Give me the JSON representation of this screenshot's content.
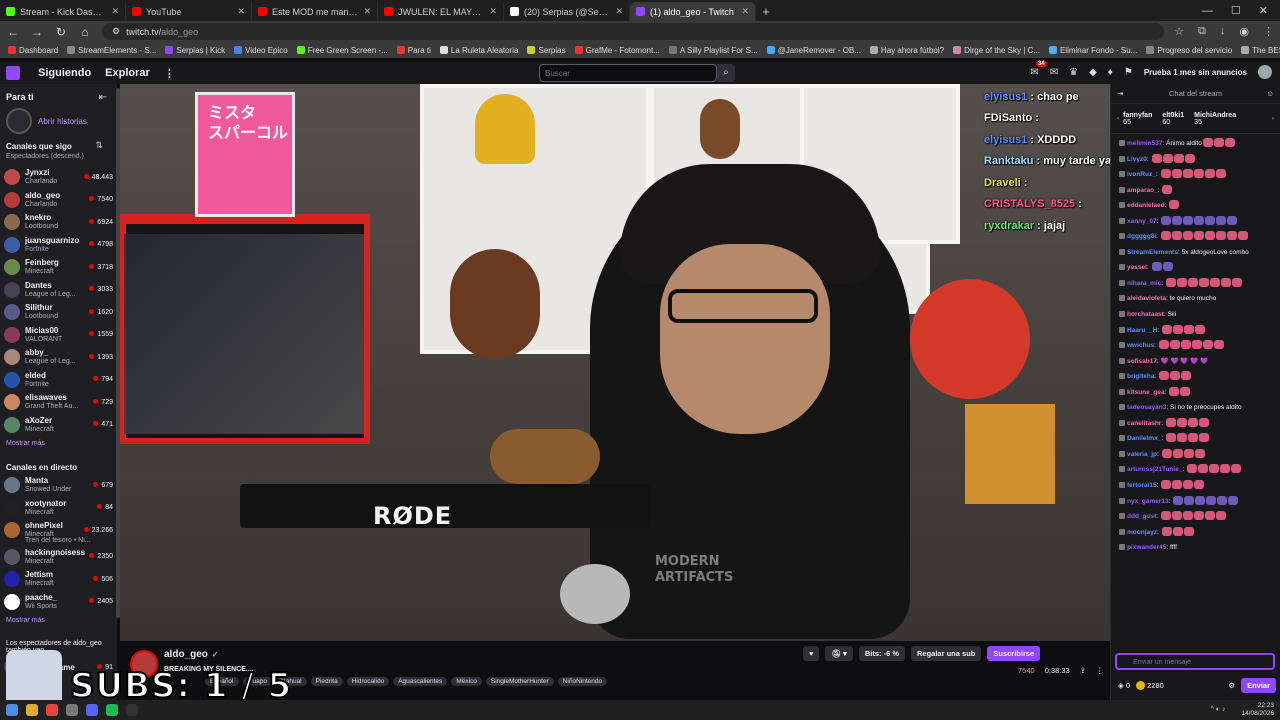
{
  "browser": {
    "tabs": [
      {
        "label": "Stream - Kick Dashboard",
        "color": "#53fc18"
      },
      {
        "label": "YouTube",
        "color": "#ff0000"
      },
      {
        "label": "Este MOD me mandó a TERAPIA",
        "color": "#ff0000"
      },
      {
        "label": "JWULEN: EL MAYOR FRAUDE DE",
        "color": "#ff0000"
      },
      {
        "label": "(20) Serpias (@Serpias) / X",
        "color": "#ffffff"
      },
      {
        "label": "(1) aldo_geo - Twitch",
        "color": "#9147ff",
        "active": true
      }
    ],
    "new_tab": "+",
    "url_host": "twitch.tv/",
    "url_path": "aldo_geo",
    "bookmarks": [
      "Dashboard",
      "StreamElements - S...",
      "Serpias | Kick",
      "Video Epico",
      "Free Green Screen -...",
      "Para ti",
      "La Ruleta Aleatoria",
      "Serpias",
      "GrafMe - Fotomont...",
      "A Silly Playlist For S...",
      "@JaneRemover - OB...",
      "Hay ahora fútbol?",
      "Dirge of the Sky | C...",
      "Eliminar Fondo - Su...",
      "Progreso del servicio",
      "The BEST CS2 Settin...",
      "(2) TikTok - Make Yo..."
    ]
  },
  "topnav": {
    "following": "Siguiendo",
    "browse": "Explorar",
    "more": "⋮",
    "search_placeholder": "Buscar",
    "notif_count": "34",
    "prime": "Prueba 1 mes sin anuncios"
  },
  "sidebar": {
    "title": "Para ti",
    "history": "Abrir historias",
    "followed_title": "Canales que sigo",
    "followed_sub": "Espectadores (descend.)",
    "followed": [
      {
        "name": "Jynxzi",
        "game": "Charlando",
        "viewers": "48.443",
        "color": "#c24848"
      },
      {
        "name": "aldo_geo",
        "game": "Charlando",
        "viewers": "7540",
        "color": "#b53a3a"
      },
      {
        "name": "knekro",
        "game": "Lootbound",
        "viewers": "6924",
        "color": "#8a6a4a"
      },
      {
        "name": "juansguarnizo",
        "game": "Fortnite",
        "viewers": "4798",
        "color": "#3a5fa8"
      },
      {
        "name": "Feinberg",
        "game": "Minecraft",
        "viewers": "3718",
        "color": "#6a8a4a"
      },
      {
        "name": "Dantes",
        "game": "League of Leg...",
        "viewers": "3033",
        "color": "#444455"
      },
      {
        "name": "Silithur",
        "game": "Lootbound",
        "viewers": "1620",
        "color": "#5a5a8a"
      },
      {
        "name": "Micias00",
        "game": "VALORANT",
        "viewers": "1559",
        "color": "#8a3a5a"
      },
      {
        "name": "abby_",
        "game": "League of Leg...",
        "viewers": "1393",
        "color": "#aa8877"
      },
      {
        "name": "elded",
        "game": "Fortnite",
        "viewers": "794",
        "color": "#2255aa"
      },
      {
        "name": "elisawaves",
        "game": "Grand Theft Au...",
        "viewers": "729",
        "color": "#cc8866"
      },
      {
        "name": "aXoZer",
        "game": "Minecraft",
        "viewers": "471",
        "color": "#558866"
      }
    ],
    "show_more": "Mostrar más",
    "live_title": "Canales en directo",
    "live": [
      {
        "name": "Manta",
        "game": "Snowed Under",
        "viewers": "679",
        "color": "#667788"
      },
      {
        "name": "xootynator",
        "game": "Minecraft",
        "viewers": "84",
        "color": "#222222"
      },
      {
        "name": "ohnePixel",
        "game": "Minecraft",
        "viewers": "23.266",
        "color": "#aa6633",
        "extra": "Tren del tesoro • Ni..."
      },
      {
        "name": "hackingnoisess",
        "game": "Minecraft",
        "viewers": "2350",
        "color": "#555566"
      },
      {
        "name": "Jettism",
        "game": "Minecraft",
        "viewers": "506",
        "color": "#2222aa"
      },
      {
        "name": "paache_",
        "game": "Wii Sports",
        "viewers": "2405",
        "color": "#ffffff"
      }
    ],
    "show_more_2": "Mostrar más",
    "also_watch": "Los espectadores de aldo_geo también ven",
    "also": {
      "name": "Ataplaygame",
      "viewers": "91"
    }
  },
  "stream": {
    "name": "aldo_geo",
    "title": "BREAKING MY SILENCE....",
    "tags": [
      "Español",
      "Guapo",
      "Nahual",
      "Piedrita",
      "Hidrocalido",
      "Aguascalientes",
      "México",
      "SingleMotherHunter",
      "NiñoNintendo"
    ],
    "bits": "Bits: -6 %",
    "gift": "Regalar una sub",
    "subscribe": "Suscribirse",
    "viewers": "7540",
    "uptime": "0:38:33",
    "overlay_subs": "SUBS: 1 / 5",
    "mic_brand": "RØDE",
    "shirt": [
      "MODERN",
      "ARTIFACTS"
    ],
    "box_text": [
      "ミスタ",
      "スパーコル"
    ]
  },
  "overlay_chat": [
    {
      "user": "elyisus1",
      "color": "#5c8fff",
      "msg": "chao pe"
    },
    {
      "user": "FDiSanto",
      "color": "#ffffff",
      "msg": ""
    },
    {
      "user": "elyisus1",
      "color": "#5c8fff",
      "msg": "XDDDD"
    },
    {
      "user": "Ranktaku",
      "color": "#9fdcff",
      "msg": "muy tarde ya le dire hate a pumplow"
    },
    {
      "user": "Draveli",
      "color": "#e5e544",
      "msg": ""
    },
    {
      "user": "CRISTALYS_8525",
      "color": "#ff5a8a",
      "msg": ""
    },
    {
      "user": "ryxdrakar",
      "color": "#6fe06f",
      "msg": "jajaj"
    }
  ],
  "chat": {
    "title": "Chat del stream",
    "leaderboard": [
      {
        "name": "fannyfan",
        "pts": "65"
      },
      {
        "name": "elt0ki1",
        "pts": "60"
      },
      {
        "name": "MichiAndrea",
        "pts": "35"
      }
    ],
    "messages": [
      {
        "user": "melimin537",
        "color": "#9b59ff",
        "text": "Ánimo aldito",
        "emotes": 3
      },
      {
        "user": "Livyz0",
        "color": "#5c8fff",
        "text": "",
        "emotes": 4
      },
      {
        "user": "ivonRuz_",
        "color": "#5c8fff",
        "text": "",
        "emotes": 6
      },
      {
        "user": "amparao_",
        "color": "#ff69b4",
        "text": "",
        "emotes": 1
      },
      {
        "user": "eddanielaed",
        "color": "#ff69b4",
        "text": "",
        "emotes": 1
      },
      {
        "user": "xanny_07",
        "color": "#9b59ff",
        "text": "",
        "emotes": 7,
        "purple": true
      },
      {
        "user": "dggggg8i",
        "color": "#5c8fff",
        "text": "",
        "emotes": 8
      },
      {
        "user": "StreamElements",
        "color": "#5c8fff",
        "text": "5x aldogeoLove combo",
        "emotes": 0
      },
      {
        "user": "yessel",
        "color": "#ff69b4",
        "text": "",
        "emotes": 2,
        "purple": true
      },
      {
        "user": "nihara_mic",
        "color": "#9b59ff",
        "text": "",
        "emotes": 7
      },
      {
        "user": "aleidavioleta",
        "color": "#ff69b4",
        "text": "te quiero mucho",
        "emotes": 0
      },
      {
        "user": "horchataast",
        "color": "#ff69b4",
        "text": "Siii",
        "emotes": 0
      },
      {
        "user": "Haaru__H",
        "color": "#5c8fff",
        "text": "",
        "emotes": 4
      },
      {
        "user": "wwichus",
        "color": "#5c8fff",
        "text": "",
        "emotes": 6
      },
      {
        "user": "sofisab17",
        "color": "#ff69b4",
        "text": "💜 💜 💜 💜 💜",
        "emotes": 0
      },
      {
        "user": "brigiteha",
        "color": "#5c8fff",
        "text": "",
        "emotes": 3
      },
      {
        "user": "kitsune_gea",
        "color": "#ff69b4",
        "text": "",
        "emotes": 2
      },
      {
        "user": "tadeosayan3",
        "color": "#9b59ff",
        "text": "Si no te preocupes aldito",
        "emotes": 0
      },
      {
        "user": "canelitashr",
        "color": "#ff69b4",
        "text": "",
        "emotes": 4
      },
      {
        "user": "Danilelmx_",
        "color": "#5c8fff",
        "text": "",
        "emotes": 4
      },
      {
        "user": "valeria_jp",
        "color": "#5c8fff",
        "text": "",
        "emotes": 4
      },
      {
        "user": "arturossj21Tunie_",
        "color": "#9b59ff",
        "text": "",
        "emotes": 5
      },
      {
        "user": "fertoral15",
        "color": "#5c8fff",
        "text": "",
        "emotes": 4
      },
      {
        "user": "nyx_gamer13",
        "color": "#9b59ff",
        "text": "",
        "emotes": 6,
        "purple": true
      },
      {
        "user": "ddd_gust",
        "color": "#9b59ff",
        "text": "",
        "emotes": 6
      },
      {
        "user": "moonjayz",
        "color": "#5c8fff",
        "text": "",
        "emotes": 3
      },
      {
        "user": "pixwander45",
        "color": "#9b59ff",
        "text": "ffff",
        "emotes": 0
      }
    ],
    "input_placeholder": "Enviar un mensaje",
    "points": "0",
    "coins": "2280",
    "send": "Enviar"
  },
  "taskbar": {
    "time": "22:23",
    "date": "14/08/2026"
  }
}
